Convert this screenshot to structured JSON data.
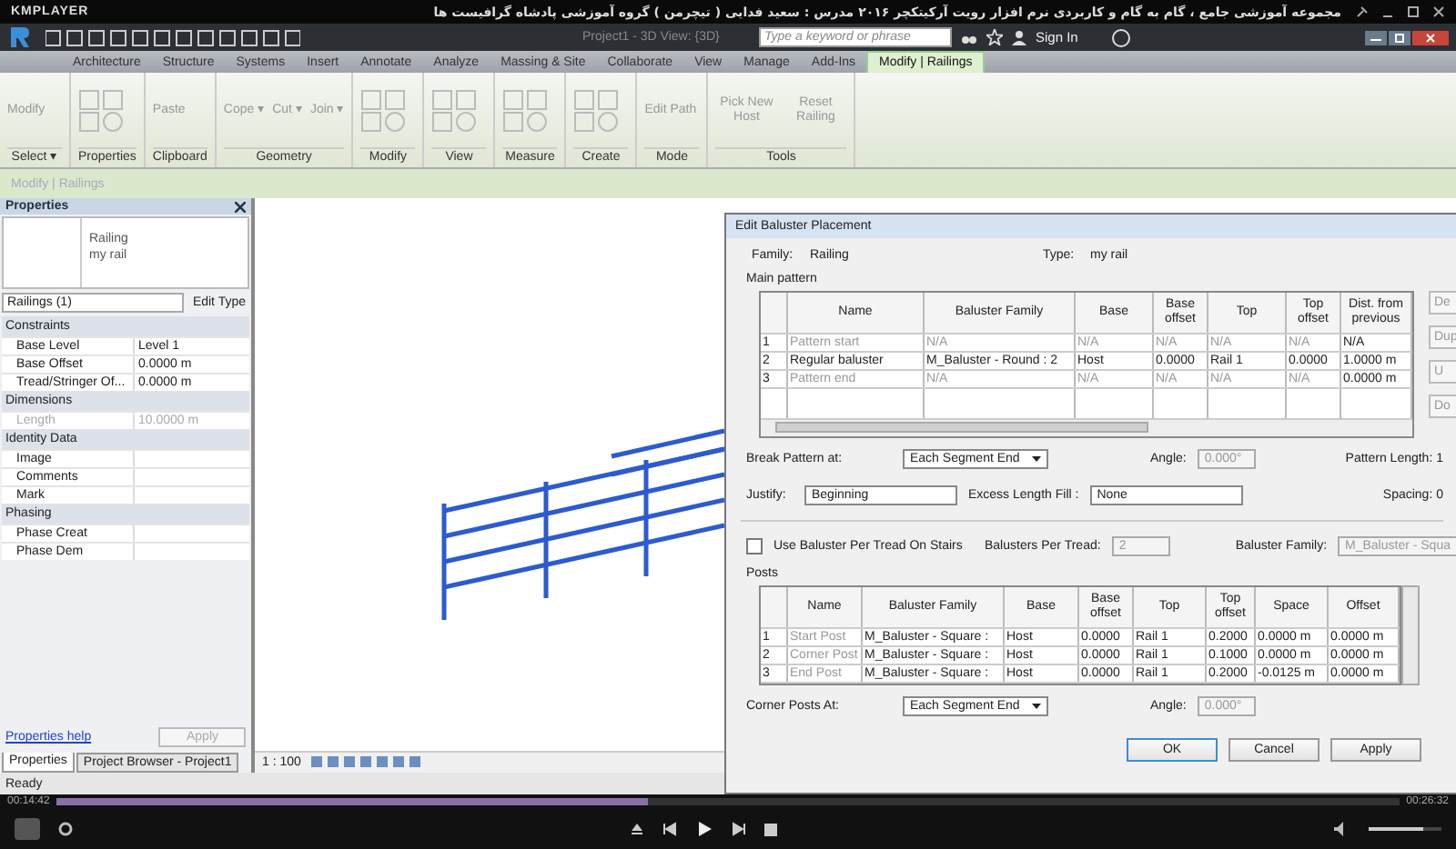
{
  "player": {
    "app_name": "KMPLAYER",
    "title": "مجموعه آموزشی جامع ، گام به گام و کاربردی نرم افزار رویت آرکیتکچر ۲۰۱۶  مدرس : سعید فدایی ( تیچرمن ) گروه آموزشی پادشاه گرافیست ها",
    "time_elapsed": "00:14:42",
    "time_total": "00:26:32",
    "progress": {
      "level": 0.44
    },
    "volume": {
      "level": 0.75
    }
  },
  "revit": {
    "window_title": "Project1 - 3D View: {3D}",
    "search": {
      "placeholder": "Type a keyword or phrase"
    },
    "sign_in": "Sign In",
    "tabs": [
      {
        "label": "Architecture",
        "selected": false
      },
      {
        "label": "Structure",
        "selected": false
      },
      {
        "label": "Systems",
        "selected": false
      },
      {
        "label": "Insert",
        "selected": false
      },
      {
        "label": "Annotate",
        "selected": false
      },
      {
        "label": "Analyze",
        "selected": false
      },
      {
        "label": "Massing & Site",
        "selected": false
      },
      {
        "label": "Collaborate",
        "selected": false
      },
      {
        "label": "View",
        "selected": false
      },
      {
        "label": "Manage",
        "selected": false
      },
      {
        "label": "Add-Ins",
        "selected": false
      },
      {
        "label": "Modify | Railings",
        "selected": true
      }
    ],
    "ribbon": [
      {
        "label": "Select ▾",
        "buttons": [
          "Modify"
        ]
      },
      {
        "label": "Properties"
      },
      {
        "label": "Clipboard",
        "buttons": [
          "Paste"
        ]
      },
      {
        "label": "Geometry",
        "buttons": [
          "Cope ▾",
          "Cut ▾",
          "Join ▾"
        ]
      },
      {
        "label": "Modify"
      },
      {
        "label": "View"
      },
      {
        "label": "Measure"
      },
      {
        "label": "Create"
      },
      {
        "label": "Mode",
        "buttons": [
          "Edit Path"
        ]
      },
      {
        "label": "Tools",
        "buttons": [
          "Pick New Host",
          "Reset Railing"
        ]
      }
    ],
    "context_label": "Modify | Railings",
    "properties": {
      "title": "Properties",
      "type_family": "Railing",
      "type_name": "my rail",
      "selector": "Railings (1)",
      "edit_type": "Edit Type",
      "groups": [
        {
          "label": "Constraints",
          "params": [
            {
              "name": "Base Level",
              "value": "Level 1",
              "disabled": false
            },
            {
              "name": "Base Offset",
              "value": "0.0000 m",
              "disabled": false
            },
            {
              "name": "Tread/Stringer Of...",
              "value": "0.0000 m",
              "disabled": false
            }
          ]
        },
        {
          "label": "Dimensions",
          "params": [
            {
              "name": "Length",
              "value": "10.0000 m",
              "disabled": true
            }
          ]
        },
        {
          "label": "Identity Data",
          "params": [
            {
              "name": "Image",
              "disabled": false
            },
            {
              "name": "Comments",
              "disabled": false
            },
            {
              "name": "Mark",
              "disabled": false
            }
          ]
        },
        {
          "label": "Phasing",
          "params": [
            {
              "name": "Phase Creat",
              "disabled": false
            },
            {
              "name": "Phase Dem",
              "disabled": false
            }
          ]
        }
      ],
      "help_link": "Properties help",
      "apply": "Apply",
      "tabs": [
        {
          "label": "Properties",
          "selected": true
        },
        {
          "label": "Project Browser - Project1",
          "selected": false
        }
      ]
    },
    "view": {
      "scale": "1 : 100"
    },
    "status_bar": "Ready"
  },
  "dialog": {
    "title": "Edit Baluster Placement",
    "family_label": "Family:",
    "family": "Railing",
    "type_label": "Type:",
    "type": "my rail",
    "main_pattern": {
      "label": "Main pattern",
      "columns": [
        "Name",
        "Baluster Family",
        "Base",
        "Base offset",
        "Top",
        "Top offset",
        "Dist. from previous"
      ],
      "rows": [
        {
          "num": "1",
          "name_disabled": true,
          "cells": [
            "Pattern start",
            "N/A",
            "N/A",
            "N/A",
            "N/A",
            "N/A",
            "N/A"
          ]
        },
        {
          "num": "2",
          "name_disabled": false,
          "cells": [
            "Regular baluster",
            "M_Baluster - Round : 2",
            "Host",
            "0.0000",
            "Rail 1",
            "0.0000",
            "1.0000 m"
          ]
        },
        {
          "num": "3",
          "name_disabled": true,
          "cells": [
            "Pattern end",
            "N/A",
            "N/A",
            "N/A",
            "N/A",
            "N/A",
            "0.0000 m"
          ]
        }
      ],
      "side_buttons": [
        "De",
        "Dup",
        "U",
        "Do"
      ]
    },
    "break_label": "Break Pattern at:",
    "break_value": "Each Segment End",
    "angle_label": "Angle:",
    "angle_value": "0.000°",
    "pattern_length_label": "Pattern Length: 1",
    "justify_label": "Justify:",
    "justify_value": "Beginning",
    "excess_label": "Excess Length Fill :",
    "excess_value": "None",
    "spacing_label": "Spacing: 0",
    "per_tread": {
      "label": "Use Baluster Per Tread On Stairs",
      "checked": false
    },
    "per_tread_count_label": "Balusters Per Tread:",
    "per_tread_count": "2",
    "tread_family_label": "Baluster Family:",
    "tread_family": "M_Baluster - Squa",
    "posts": {
      "label": "Posts",
      "columns": [
        "Name",
        "Baluster Family",
        "Base",
        "Base offset",
        "Top",
        "Top offset",
        "Space",
        "Offset"
      ],
      "rows": [
        {
          "num": "1",
          "name_disabled": true,
          "cells": [
            "Start Post",
            "M_Baluster - Square :",
            "Host",
            "0.0000",
            "Rail 1",
            "0.2000",
            "0.0000 m",
            "0.0000 m"
          ]
        },
        {
          "num": "2",
          "name_disabled": true,
          "cells": [
            "Corner Post",
            "M_Baluster - Square :",
            "Host",
            "0.0000",
            "Rail 1",
            "0.1000",
            "0.0000 m",
            "0.0000 m"
          ]
        },
        {
          "num": "3",
          "name_disabled": true,
          "cells": [
            "End Post",
            "M_Baluster - Square :",
            "Host",
            "0.0000",
            "Rail 1",
            "0.2000",
            "-0.0125 m",
            "0.0000 m"
          ]
        }
      ]
    },
    "corner_label": "Corner Posts At:",
    "corner_value": "Each Segment End",
    "corner_angle_label": "Angle:",
    "corner_angle_value": "0.000°",
    "buttons": [
      "OK",
      "Cancel",
      "Apply"
    ]
  }
}
